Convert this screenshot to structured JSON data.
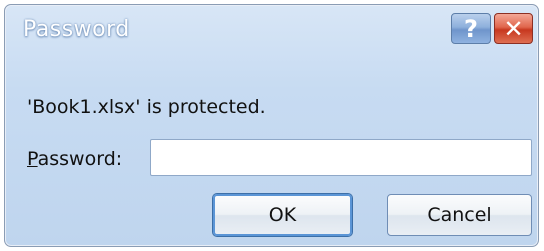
{
  "dialog": {
    "title": "Password",
    "help_glyph": "?",
    "close_glyph": "✕",
    "message": "'Book1.xlsx' is protected.",
    "password_label_mnemonic": "P",
    "password_label_rest": "assword:",
    "password_value": "",
    "ok_label": "OK",
    "cancel_label": "Cancel"
  },
  "colors": {
    "title_text": "#ffffff",
    "window_background": "#c7dbf2",
    "close_button": "#d7553d",
    "help_button": "#7e9fd0"
  },
  "icons": {
    "help": "question-mark-icon",
    "close": "close-x-icon"
  }
}
